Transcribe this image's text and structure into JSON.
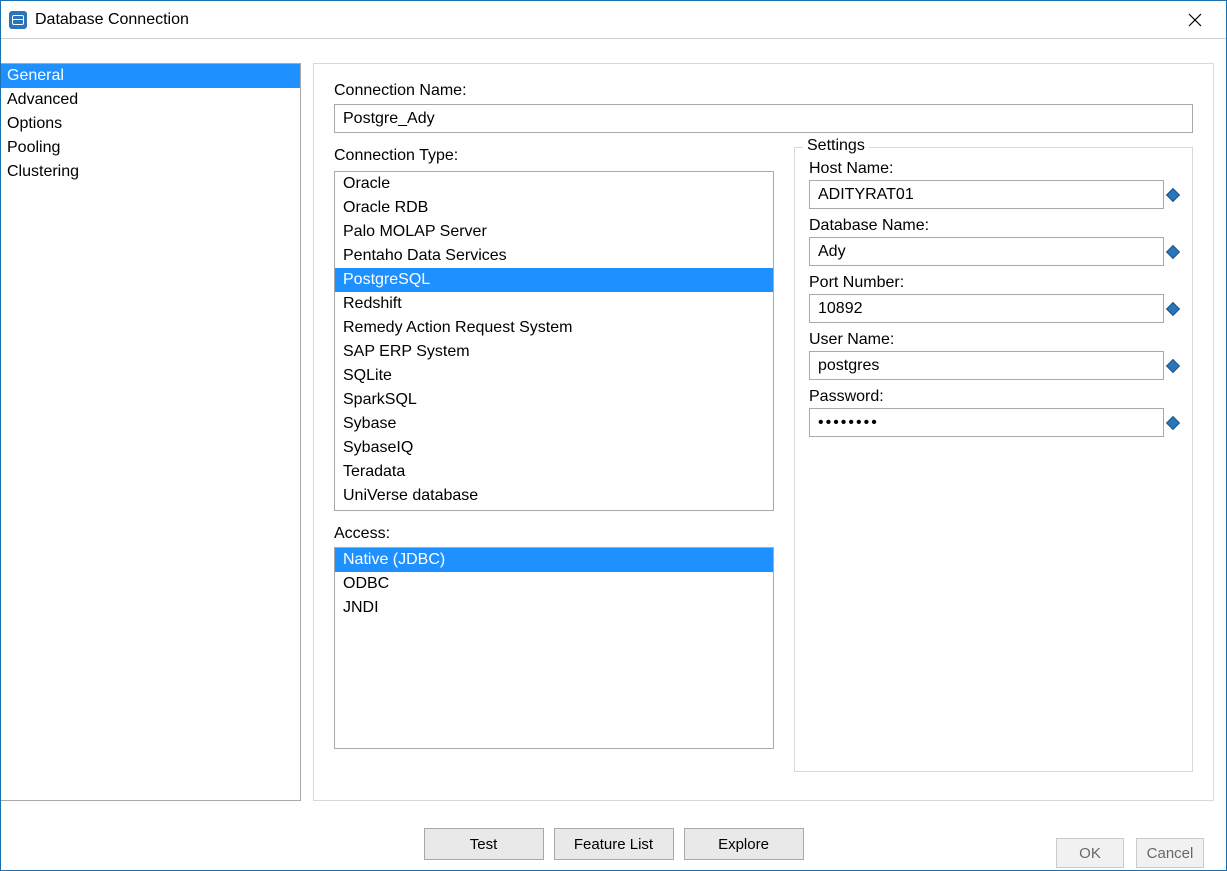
{
  "window": {
    "title": "Database Connection"
  },
  "sidebar": {
    "items": [
      "General",
      "Advanced",
      "Options",
      "Pooling",
      "Clustering"
    ],
    "selected": "General"
  },
  "connection_name": {
    "label": "Connection Name:",
    "value": "Postgre_Ady"
  },
  "connection_type": {
    "label": "Connection Type:",
    "options": [
      "Oracle",
      "Oracle RDB",
      "Palo MOLAP Server",
      "Pentaho Data Services",
      "PostgreSQL",
      "Redshift",
      "Remedy Action Request System",
      "SAP ERP System",
      "SQLite",
      "SparkSQL",
      "Sybase",
      "SybaseIQ",
      "Teradata",
      "UniVerse database"
    ],
    "selected": "PostgreSQL"
  },
  "access": {
    "label": "Access:",
    "options": [
      "Native (JDBC)",
      "ODBC",
      "JNDI"
    ],
    "selected": "Native (JDBC)"
  },
  "settings": {
    "legend": "Settings",
    "host_name": {
      "label": "Host Name:",
      "value": "ADITYRAT01"
    },
    "database_name": {
      "label": "Database Name:",
      "value": "Ady"
    },
    "port_number": {
      "label": "Port Number:",
      "value": "10892"
    },
    "user_name": {
      "label": "User Name:",
      "value": "postgres"
    },
    "password": {
      "label": "Password:",
      "value": "••••••••"
    }
  },
  "buttons": {
    "test": "Test",
    "feature_list": "Feature List",
    "explore": "Explore",
    "ok": "OK",
    "cancel": "Cancel"
  }
}
